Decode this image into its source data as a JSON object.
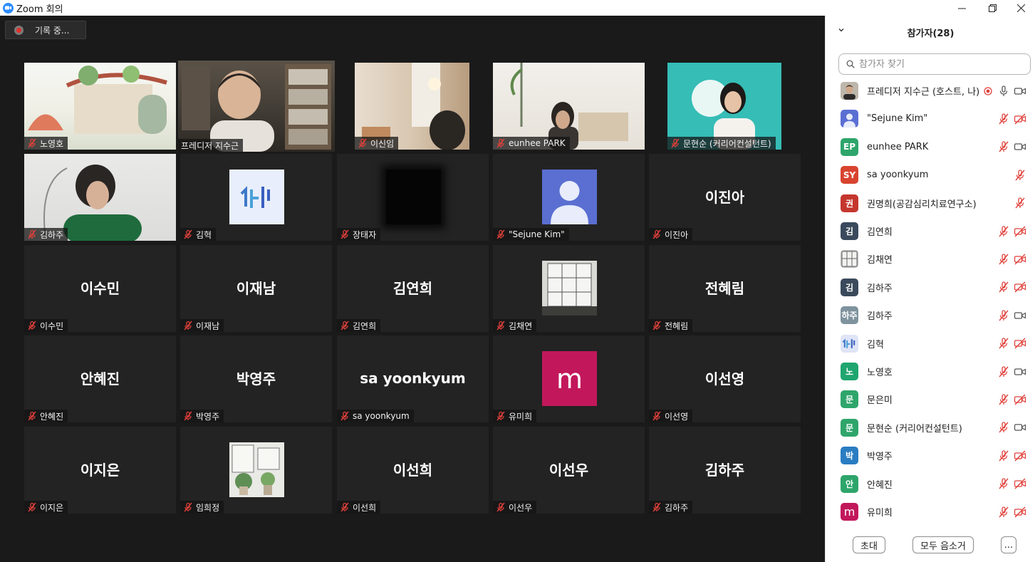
{
  "window": {
    "title": "Zoom 회의",
    "logo_text": "zoom"
  },
  "recording": {
    "label": "기록 중..."
  },
  "tiles": [
    {
      "name": "노영호",
      "big": "",
      "kind": "photo"
    },
    {
      "name": "프레디저 지수근",
      "big": "",
      "kind": "photo",
      "active": true
    },
    {
      "name": "이신임",
      "big": "",
      "kind": "photo"
    },
    {
      "name": "eunhee PARK",
      "big": "",
      "kind": "photo"
    },
    {
      "name": "문현순 (커리어컨설턴트)",
      "big": "",
      "kind": "photo"
    },
    {
      "name": "김하주",
      "big": "",
      "kind": "photo"
    },
    {
      "name": "김혁",
      "big": "",
      "kind": "avatar"
    },
    {
      "name": "장태자",
      "big": "",
      "kind": "avatar"
    },
    {
      "name": "\"Sejune Kim\"",
      "big": "",
      "kind": "avatar"
    },
    {
      "name": "이진아",
      "big": "이진아",
      "kind": "text"
    },
    {
      "name": "이수민",
      "big": "이수민",
      "kind": "text"
    },
    {
      "name": "이재남",
      "big": "이재남",
      "kind": "text"
    },
    {
      "name": "김연희",
      "big": "김연희",
      "kind": "text"
    },
    {
      "name": "김채연",
      "big": "",
      "kind": "avatar"
    },
    {
      "name": "전혜림",
      "big": "전혜림",
      "kind": "text"
    },
    {
      "name": "안혜진",
      "big": "안혜진",
      "kind": "text"
    },
    {
      "name": "박영주",
      "big": "박영주",
      "kind": "text"
    },
    {
      "name": "sa yoonkyum",
      "big": "sa yoonkyum",
      "kind": "text"
    },
    {
      "name": "유미희",
      "big": "m",
      "kind": "avatar"
    },
    {
      "name": "이선영",
      "big": "이선영",
      "kind": "text"
    },
    {
      "name": "이지은",
      "big": "이지은",
      "kind": "text"
    },
    {
      "name": "임희정",
      "big": "",
      "kind": "avatar"
    },
    {
      "name": "이선희",
      "big": "이선희",
      "kind": "text"
    },
    {
      "name": "이선우",
      "big": "이선우",
      "kind": "text"
    },
    {
      "name": "김하주",
      "big": "김하주",
      "kind": "text"
    }
  ],
  "panel": {
    "title": "참가자(28)",
    "search_placeholder": "참가자 찾기",
    "participants": [
      {
        "name": "프레디저 지수근 (호스트, 나)",
        "avatar": "",
        "color": "#6b6b6b",
        "mic": "on",
        "video": "on",
        "recording": true
      },
      {
        "name": "\"Sejune Kim\"",
        "avatar": "",
        "color": "#5b6fd3",
        "mic": "off",
        "video": "off"
      },
      {
        "name": "eunhee PARK",
        "avatar": "EP",
        "color": "#2ea56b",
        "mic": "off",
        "video": "on"
      },
      {
        "name": "sa yoonkyum",
        "avatar": "SY",
        "color": "#d8442f",
        "mic": "off",
        "video": "none"
      },
      {
        "name": "권명희(공감심리치료연구소)",
        "avatar": "권",
        "color": "#c4372e",
        "mic": "off",
        "video": "none"
      },
      {
        "name": "김연희",
        "avatar": "김",
        "color": "#3a4a5c",
        "mic": "off",
        "video": "off"
      },
      {
        "name": "김채연",
        "avatar": "",
        "color": "#b9b9b9",
        "mic": "off",
        "video": "off"
      },
      {
        "name": "김하주",
        "avatar": "김",
        "color": "#3a4a5c",
        "mic": "off",
        "video": "off"
      },
      {
        "name": "김하주",
        "avatar": "하주",
        "color": "#7f939e",
        "mic": "off",
        "video": "on"
      },
      {
        "name": "김혁",
        "avatar": "",
        "color": "#dfe4f6",
        "mic": "off",
        "video": "off"
      },
      {
        "name": "노영호",
        "avatar": "노",
        "color": "#1fa56f",
        "mic": "off",
        "video": "on"
      },
      {
        "name": "문은미",
        "avatar": "문",
        "color": "#2ea56b",
        "mic": "off",
        "video": "off"
      },
      {
        "name": "문현순 (커리어컨설턴트)",
        "avatar": "문",
        "color": "#2ea56b",
        "mic": "off",
        "video": "on"
      },
      {
        "name": "박영주",
        "avatar": "박",
        "color": "#2a7dc2",
        "mic": "off",
        "video": "off"
      },
      {
        "name": "안혜진",
        "avatar": "안",
        "color": "#2ea56b",
        "mic": "off",
        "video": "off"
      },
      {
        "name": "유미희",
        "avatar": "m",
        "color": "#c2185b",
        "mic": "off",
        "video": "off"
      }
    ],
    "footer": {
      "invite": "초대",
      "mute_all": "모두 음소거",
      "more": "..."
    }
  }
}
